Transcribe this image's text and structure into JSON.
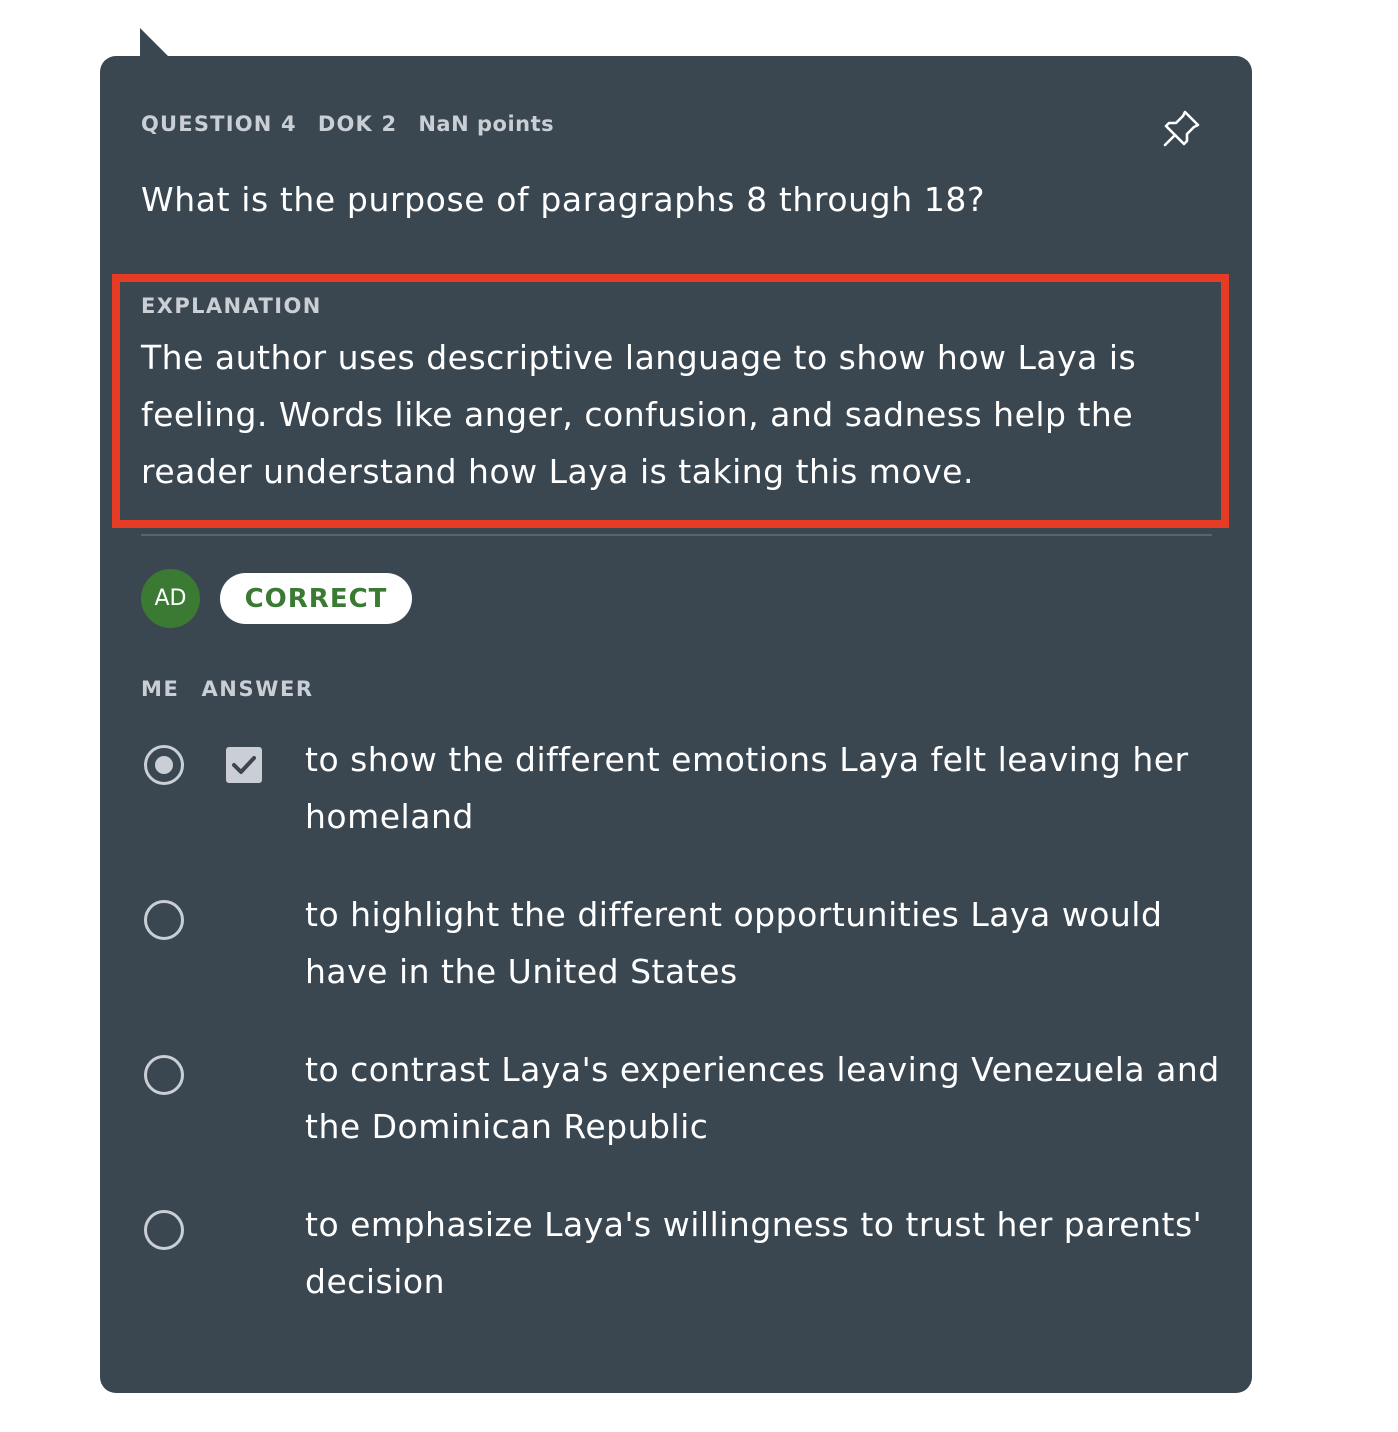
{
  "question": {
    "number_label": "QUESTION 4",
    "dok_label": "DOK 2",
    "points_label": "NaN points",
    "text": "What is the purpose of paragraphs 8 through 18?",
    "pin_icon": "pushpin-icon"
  },
  "explanation": {
    "label": "EXPLANATION",
    "text": "The author uses descriptive language to show how Laya is feeling. Words like anger, confusion, and sadness help the reader understand how Laya is taking this move."
  },
  "student": {
    "initials": "AD",
    "status": "CORRECT",
    "avatar_color": "#3a7a33"
  },
  "answer_columns": {
    "me": "ME",
    "answer": "ANSWER"
  },
  "options": [
    {
      "text": "to show the different emotions Laya felt leaving her homeland",
      "selected_by_me": true,
      "correct": true
    },
    {
      "text": "to highlight the different opportunities Laya would have in the United States",
      "selected_by_me": false,
      "correct": false
    },
    {
      "text": "to contrast Laya's experiences leaving Venezuela and the Dominican Republic",
      "selected_by_me": false,
      "correct": false
    },
    {
      "text": "to emphasize Laya's willingness to trust her parents' decision",
      "selected_by_me": false,
      "correct": false
    }
  ],
  "colors": {
    "card_background": "#3a4650",
    "highlight_border": "#e63c25",
    "correct_green": "#3a7a33"
  }
}
